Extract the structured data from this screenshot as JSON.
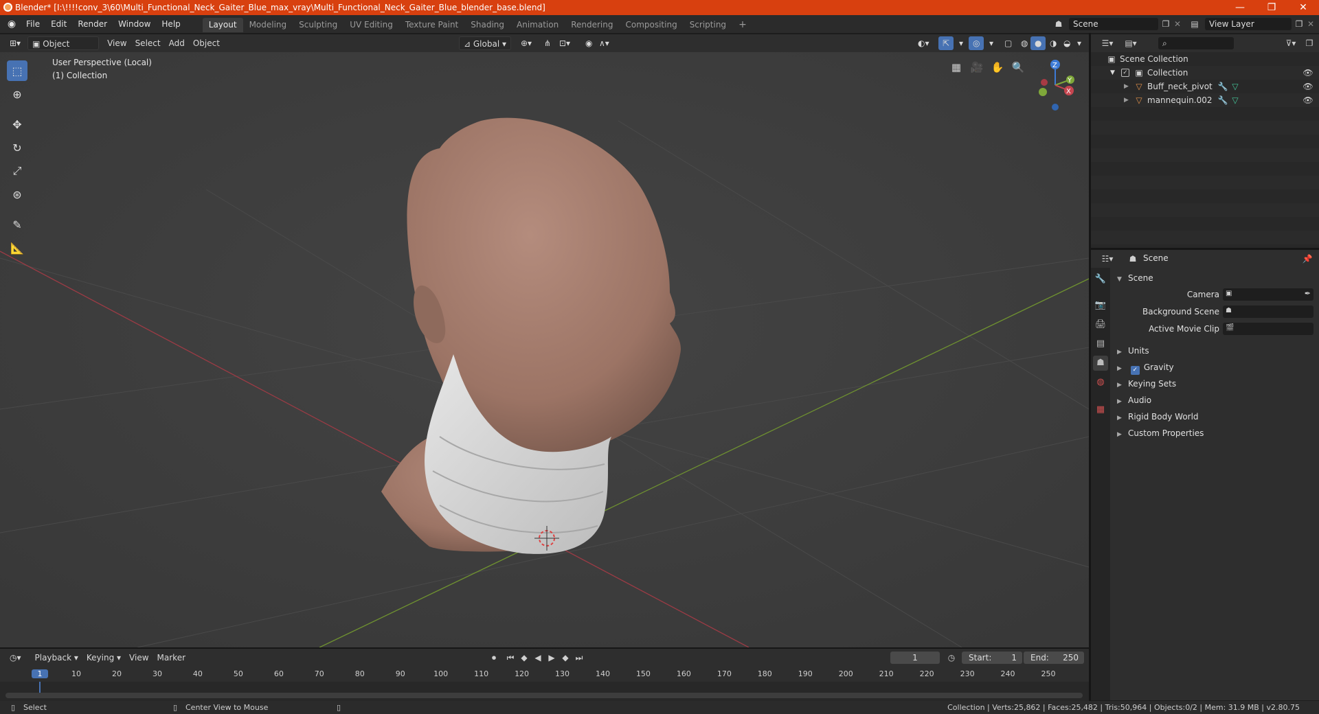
{
  "window": {
    "title": "Blender* [I:\\!!!!conv_3\\60\\Multi_Functional_Neck_Gaiter_Blue_max_vray\\Multi_Functional_Neck_Gaiter_Blue_blender_base.blend]",
    "minimize": "—",
    "restore": "❐",
    "close": "✕"
  },
  "menu": [
    "File",
    "Edit",
    "Render",
    "Window",
    "Help"
  ],
  "workspaces": [
    "Layout",
    "Modeling",
    "Sculpting",
    "UV Editing",
    "Texture Paint",
    "Shading",
    "Animation",
    "Rendering",
    "Compositing",
    "Scripting"
  ],
  "add_workspace": "+",
  "scene_selector": {
    "value": "Scene"
  },
  "view_layer_selector": {
    "value": "View Layer"
  },
  "viewport_header": {
    "mode": "Object Mode",
    "menus": [
      "View",
      "Select",
      "Add",
      "Object"
    ],
    "orientation": "Global"
  },
  "viewport": {
    "perspective_label": "User Perspective (Local)",
    "collection_label": "(1) Collection",
    "gizmo": {
      "z": "Z",
      "y": "Y",
      "x": "X"
    }
  },
  "outliner": {
    "scene_collection": "Scene Collection",
    "collection": "Collection",
    "objects": [
      "Buff_neck_pivot",
      "mannequin.002"
    ]
  },
  "properties": {
    "context": "Scene",
    "panel": "Scene",
    "fields": [
      {
        "label": "Camera",
        "value": ""
      },
      {
        "label": "Background Scene",
        "value": ""
      },
      {
        "label": "Active Movie Clip",
        "value": ""
      }
    ],
    "sections": [
      "Units",
      "Gravity",
      "Keying Sets",
      "Audio",
      "Rigid Body World",
      "Custom Properties"
    ],
    "gravity_checked": true
  },
  "timeline": {
    "menus": [
      "Playback",
      "Keying",
      "View",
      "Marker"
    ],
    "current_frame": "1",
    "start_label": "Start:",
    "start": "1",
    "end_label": "End:",
    "end": "250",
    "ticks": [
      "1",
      "10",
      "20",
      "30",
      "40",
      "50",
      "60",
      "70",
      "80",
      "90",
      "100",
      "110",
      "120",
      "130",
      "140",
      "150",
      "160",
      "170",
      "180",
      "190",
      "200",
      "210",
      "220",
      "230",
      "240",
      "250"
    ]
  },
  "statusbar": {
    "select": "Select",
    "center_view": "Center View to Mouse",
    "stats": "Collection | Verts:25,862 | Faces:25,482 | Tris:50,964 | Objects:0/2 | Mem: 31.9 MB | v2.80.75"
  },
  "colors": {
    "titlebar": "#d8400f",
    "accent": "#4772b3",
    "x_axis": "#c6454f",
    "y_axis": "#7fa83a",
    "z_axis": "#3d7bd6",
    "skin": "#a77d6e",
    "fabric": "#dcdcdc"
  }
}
